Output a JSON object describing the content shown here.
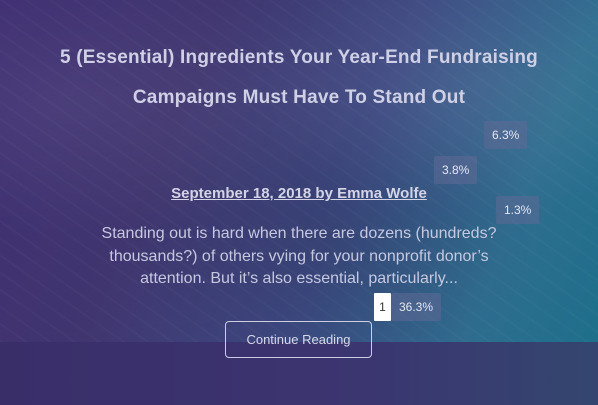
{
  "post": {
    "title": "5 (Essential) Ingredients Your Year-End Fundraising Campaigns Must Have To Stand Out",
    "meta": "September 18, 2018 by Emma Wolfe",
    "excerpt": "Standing out is hard when there are dozens (hundreds? thousands?) of others vying for your nonprofit donor’s attention. But it’s also essential, particularly...",
    "button_label": "Continue Reading"
  },
  "overlays": {
    "badge_1": "6.3%",
    "badge_2": "3.8%",
    "badge_3": "1.3%",
    "badge_4": "36.3%",
    "index_marker": "1"
  },
  "colors": {
    "hero_start": "#3f2f73",
    "hero_end": "#1d6f8a",
    "footer_band": "#3a2e69",
    "text": "#cfd0e6"
  }
}
